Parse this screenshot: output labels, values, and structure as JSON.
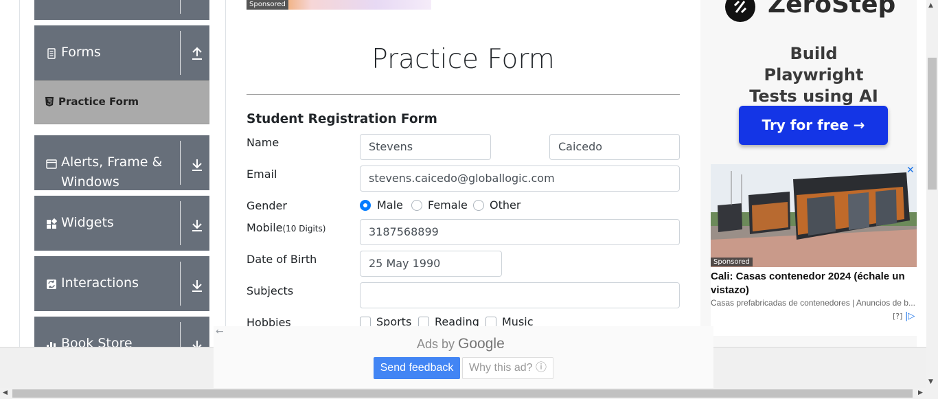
{
  "sidebar": {
    "groups": [
      {
        "label": "Forms",
        "icon": "document-icon",
        "arrow": "arrow-up-icon"
      },
      {
        "label": "Alerts, Frame &",
        "label2": "Windows",
        "icon": "window-icon",
        "arrow": "arrow-down-icon"
      },
      {
        "label": "Widgets",
        "icon": "widgets-icon",
        "arrow": "arrow-down-icon"
      },
      {
        "label": "Interactions",
        "icon": "interactions-icon",
        "arrow": "arrow-down-icon"
      },
      {
        "label": "Book Store",
        "icon": "bar-chart-icon",
        "arrow": "arrow-down-icon"
      }
    ],
    "active_item": "Practice Form"
  },
  "top_ad": {
    "sponsored": "Sponsored"
  },
  "form": {
    "title": "Practice Form",
    "subtitle": "Student Registration Form",
    "name_label": "Name",
    "first_name": "Stevens",
    "last_name": "Caicedo",
    "email_label": "Email",
    "email": "stevens.caicedo@globallogic.com",
    "gender_label": "Gender",
    "gender_options": [
      "Male",
      "Female",
      "Other"
    ],
    "gender_selected": "Male",
    "mobile_label": "Mobile",
    "mobile_hint": "(10 Digits)",
    "mobile": "3187568899",
    "dob_label": "Date of Birth",
    "dob": "25 May 1990",
    "subjects_label": "Subjects",
    "subjects": "",
    "hobbies_label": "Hobbies",
    "hobbies": [
      "Sports",
      "Reading",
      "Music"
    ]
  },
  "right_ad": {
    "brand": "ZeroStep",
    "headline": "Build Playwright Tests using AI",
    "cta": "Try for free →",
    "cta_color": "#1435e6",
    "card_sponsored": "Sponsored",
    "card_title": "Cali: Casas contenedor 2024 (échale un vistazo)",
    "card_desc": "Casas prefabricadas de contenedores | Anuncios de b...",
    "card_q": "[?]",
    "close": "✕"
  },
  "google_ads": {
    "ads_by": "Ads by",
    "google": "Google",
    "feedback": "Send feedback",
    "why": "Why this ad? ⓘ",
    "feedback_color": "#4285f4"
  },
  "colors": {
    "sidebar_group": "#676f7a",
    "active_item": "#aaaaaa",
    "radio_selected": "#007bff"
  }
}
